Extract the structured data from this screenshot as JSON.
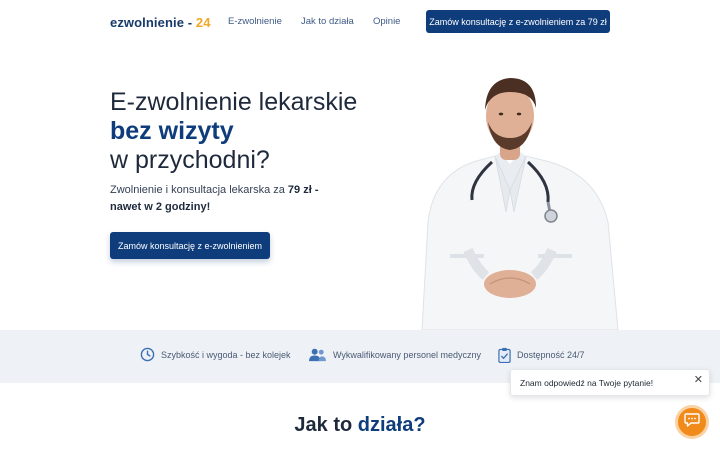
{
  "header": {
    "logo_main": "ezwolnienie",
    "logo_dash": " - ",
    "logo_num": "24",
    "nav": [
      "E-zwolnienie",
      "Jak to działa",
      "Opinie"
    ],
    "cta": "Zamów konsultację z e-zwolnieniem za 79 zł"
  },
  "hero": {
    "line1": "E-zwolnienie lekarskie",
    "line2": "bez wizyty",
    "line3": "w przychodni?",
    "sub_pre": "Zwolnienie i konsultacja lekarska za ",
    "sub_bold": "79 zł - nawet w 2 godziny!",
    "cta": "Zamów konsultację z e-zwolnieniem"
  },
  "features": [
    {
      "icon": "clock-icon",
      "label": "Szybkość i wygoda - bez kolejek"
    },
    {
      "icon": "people-icon",
      "label": "Wykwalifikowany personel medyczny"
    },
    {
      "icon": "clipboard-icon",
      "label": "Dostępność 24/7"
    }
  ],
  "chat": {
    "popup_text": "Znam odpowiedź na Twoje pytanie!",
    "close": "✕",
    "button_icon": "chat-icon"
  },
  "section": {
    "title_pre": "Jak to ",
    "title_accent": "działa?"
  },
  "colors": {
    "primary": "#0f3d7c",
    "accent": "#f0a828",
    "chat": "#f08a1a",
    "band": "#eef1f6"
  }
}
